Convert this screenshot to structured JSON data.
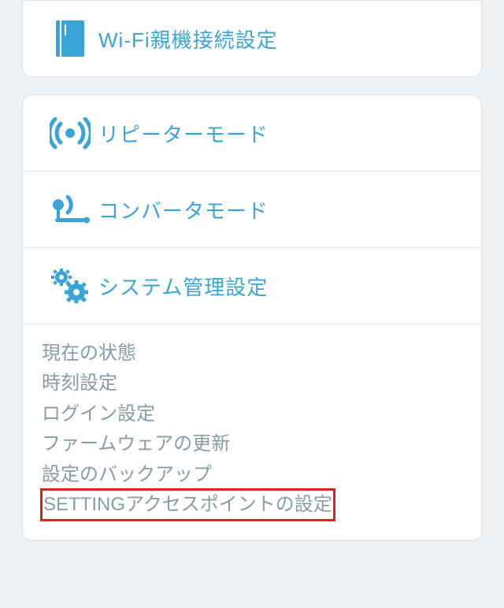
{
  "accent": "#3aa4d6",
  "muted": "#8a9ba6",
  "highlight": "#d9241a",
  "top": {
    "label": "Wi-Fi親機接続設定"
  },
  "rows": {
    "repeater": "リピーターモード",
    "converter": "コンバータモード",
    "system": "システム管理設定"
  },
  "sub": [
    "現在の状態",
    "時刻設定",
    "ログイン設定",
    "ファームウェアの更新",
    "設定のバックアップ",
    "SETTINGアクセスポイントの設定"
  ]
}
